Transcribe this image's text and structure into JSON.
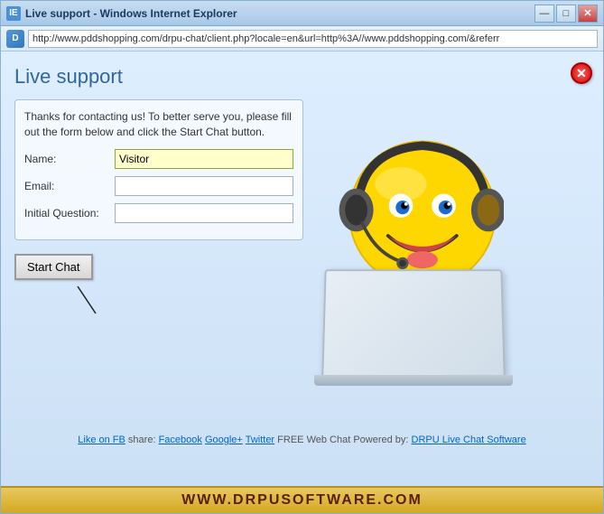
{
  "window": {
    "title": "Live support - Windows Internet Explorer",
    "icon_label": "IE",
    "close_label": "✕",
    "minimize_label": "—",
    "maximize_label": "□"
  },
  "address_bar": {
    "icon_label": "D",
    "url": "http://www.pddshopping.com/drpu-chat/client.php?locale=en&url=http%3A//www.pddshopping.com/&referr"
  },
  "content": {
    "header": "Live support",
    "close_btn": "✕",
    "description": "Thanks for contacting us! To better serve you, please fill out the form below and click the Start Chat button.",
    "form": {
      "name_label": "Name:",
      "name_value": "Visitor",
      "email_label": "Email:",
      "email_value": "",
      "question_label": "Initial Question:",
      "question_value": ""
    },
    "start_chat_label": "Start Chat"
  },
  "footer": {
    "like_on_fb": "Like on FB",
    "share_label": "share:",
    "facebook_label": "Facebook",
    "googleplus_label": "Google+",
    "twitter_label": "Twitter",
    "free_web_chat_label": "FREE Web Chat Powered by:",
    "drpu_label": "DRPU Live Chat Software"
  },
  "brand": {
    "text": "WWW.DRPUSOFTWARE.COM"
  }
}
